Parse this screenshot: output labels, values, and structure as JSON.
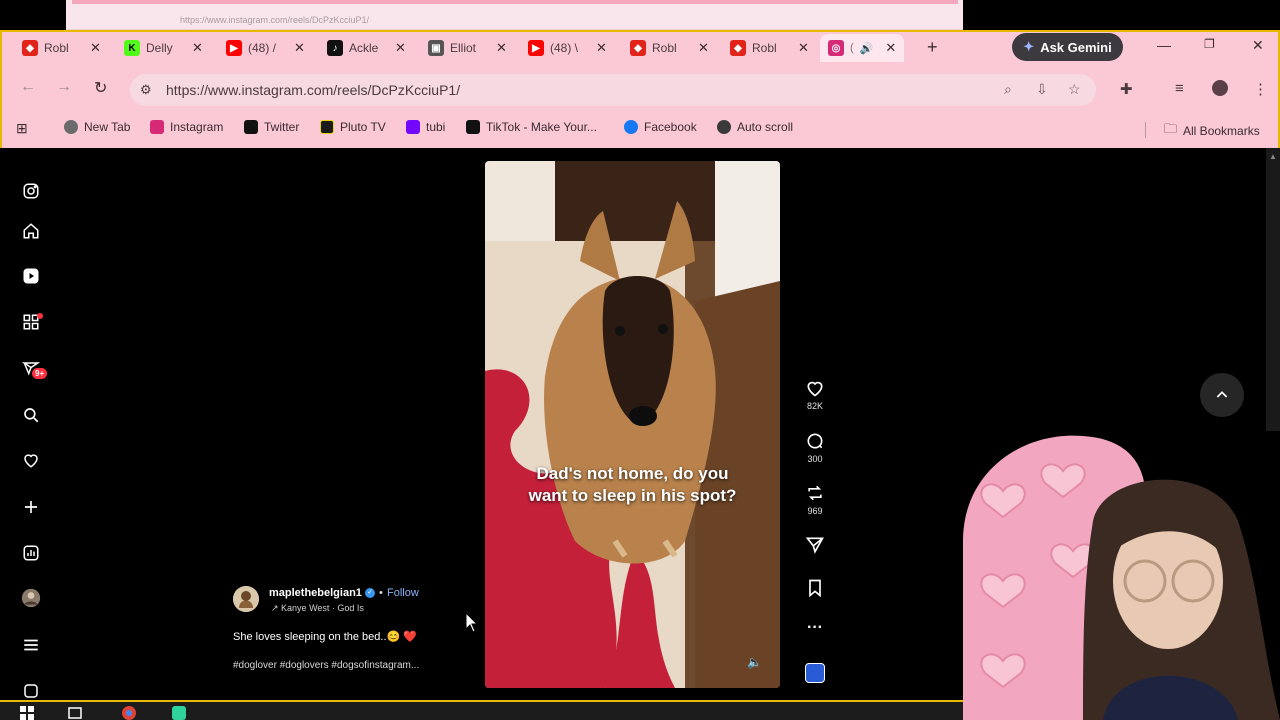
{
  "tabs": [
    {
      "title": "Robl",
      "icon": "roblox-icon",
      "color": "#e2231a"
    },
    {
      "title": "Delly",
      "icon": "kick-icon",
      "color": "#53fc18"
    },
    {
      "title": "(48) /",
      "icon": "youtube-icon",
      "color": "#ff0000"
    },
    {
      "title": "Ackle",
      "icon": "tiktok-icon",
      "color": "#111111"
    },
    {
      "title": "Elliot",
      "icon": "generic-site-icon",
      "color": "#555555"
    },
    {
      "title": "(48) \\",
      "icon": "youtube-icon",
      "color": "#ff0000"
    },
    {
      "title": "Robl",
      "icon": "roblox-icon",
      "color": "#e2231a"
    },
    {
      "title": "Robl",
      "icon": "roblox-icon",
      "color": "#e2231a"
    },
    {
      "title": "(",
      "icon": "instagram-icon",
      "color": "#d62976",
      "active": true
    }
  ],
  "gemini_label": "Ask Gemini",
  "address": {
    "url": "https://www.instagram.com/reels/DcPzKcciuP1/"
  },
  "ghost_url": "https://www.instagram.com/reels/DcPzKcciuP1/",
  "bookmarks": [
    {
      "label": "New Tab",
      "icon": "chrome-icon"
    },
    {
      "label": "Instagram",
      "icon": "instagram-icon"
    },
    {
      "label": "Twitter",
      "icon": "twitter-icon"
    },
    {
      "label": "Pluto TV",
      "icon": "plutotv-icon"
    },
    {
      "label": "tubi",
      "icon": "tubi-icon"
    },
    {
      "label": "TikTok - Make Your...",
      "icon": "tiktok-icon"
    },
    {
      "label": "Facebook",
      "icon": "facebook-icon"
    },
    {
      "label": "Auto scroll",
      "icon": "autoscroll-icon"
    }
  ],
  "all_bookmarks": "All Bookmarks",
  "sidebar": {
    "notification_badge": "9+"
  },
  "reel": {
    "overlay_line1": "Dad's not home, do you",
    "overlay_line2": "want to sleep in his spot?",
    "likes": "82K",
    "comments": "300",
    "reposts": "969",
    "username": "maplethebelgian1",
    "follow": "Follow",
    "music": "Kanye West · God Is",
    "description": "She loves sleeping on the bed..😊 ❤️",
    "hashtags": "#doglover #doglovers #dogsofinstagram..."
  },
  "colors": {
    "chrome_bg": "#fbc9d6",
    "accent_border": "#e8b900",
    "page_bg": "#000000",
    "badge_red": "#ff3040",
    "follow_blue": "#8ab4f8"
  }
}
